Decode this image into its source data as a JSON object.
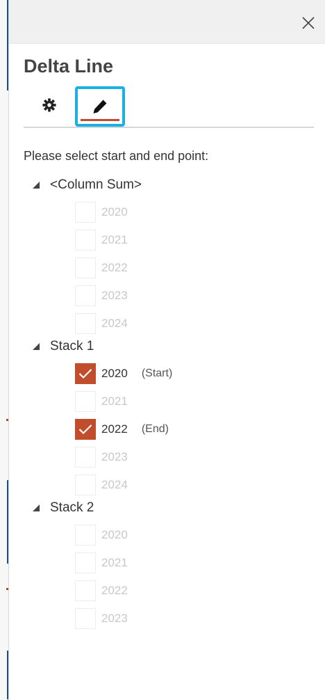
{
  "pane": {
    "title": "Delta Line",
    "close_icon": "close-icon",
    "tabs": [
      {
        "name": "settings",
        "icon": "gear-icon",
        "selected": false
      },
      {
        "name": "edit",
        "icon": "pencil-icon",
        "selected": true
      }
    ]
  },
  "instruction": "Please select start and end point:",
  "groups": [
    {
      "label": "<Column Sum>",
      "expanded": true,
      "items": [
        {
          "label": "2020",
          "checked": false,
          "tag": ""
        },
        {
          "label": "2021",
          "checked": false,
          "tag": ""
        },
        {
          "label": "2022",
          "checked": false,
          "tag": ""
        },
        {
          "label": "2023",
          "checked": false,
          "tag": ""
        },
        {
          "label": "2024",
          "checked": false,
          "tag": ""
        }
      ]
    },
    {
      "label": "Stack 1",
      "expanded": true,
      "items": [
        {
          "label": "2020",
          "checked": true,
          "tag": "(Start)"
        },
        {
          "label": "2021",
          "checked": false,
          "tag": ""
        },
        {
          "label": "2022",
          "checked": true,
          "tag": "(End)"
        },
        {
          "label": "2023",
          "checked": false,
          "tag": ""
        },
        {
          "label": "2024",
          "checked": false,
          "tag": ""
        }
      ]
    },
    {
      "label": "Stack 2",
      "expanded": true,
      "items": [
        {
          "label": "2020",
          "checked": false,
          "tag": ""
        },
        {
          "label": "2021",
          "checked": false,
          "tag": ""
        },
        {
          "label": "2022",
          "checked": false,
          "tag": ""
        },
        {
          "label": "2023",
          "checked": false,
          "tag": ""
        }
      ]
    }
  ],
  "colors": {
    "accent": "#c24d2c",
    "focus_ring": "#1bb0e3",
    "disabled_text": "#c8c8c8",
    "text": "#333333"
  }
}
